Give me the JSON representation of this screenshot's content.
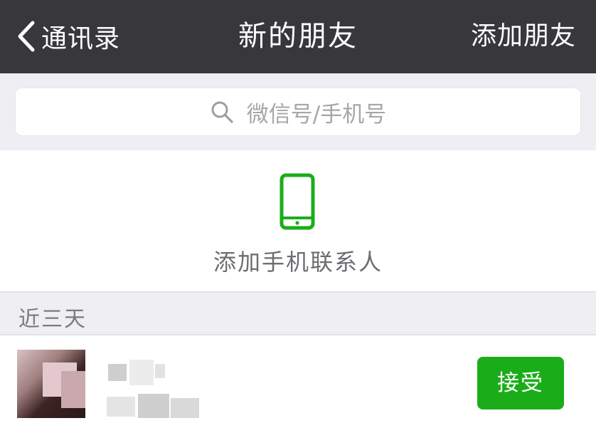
{
  "navbar": {
    "back_label": "通讯录",
    "title": "新的朋友",
    "action_label": "添加朋友"
  },
  "search": {
    "placeholder": "微信号/手机号",
    "icon": "search-icon"
  },
  "add_contacts": {
    "label": "添加手机联系人",
    "icon": "mobile-phone-icon"
  },
  "section": {
    "label": "近三天"
  },
  "requests": [
    {
      "accept_label": "接受"
    }
  ],
  "colors": {
    "navbar_bg": "#38373c",
    "accent_green": "#1aad19",
    "page_bg": "#efeff3"
  }
}
